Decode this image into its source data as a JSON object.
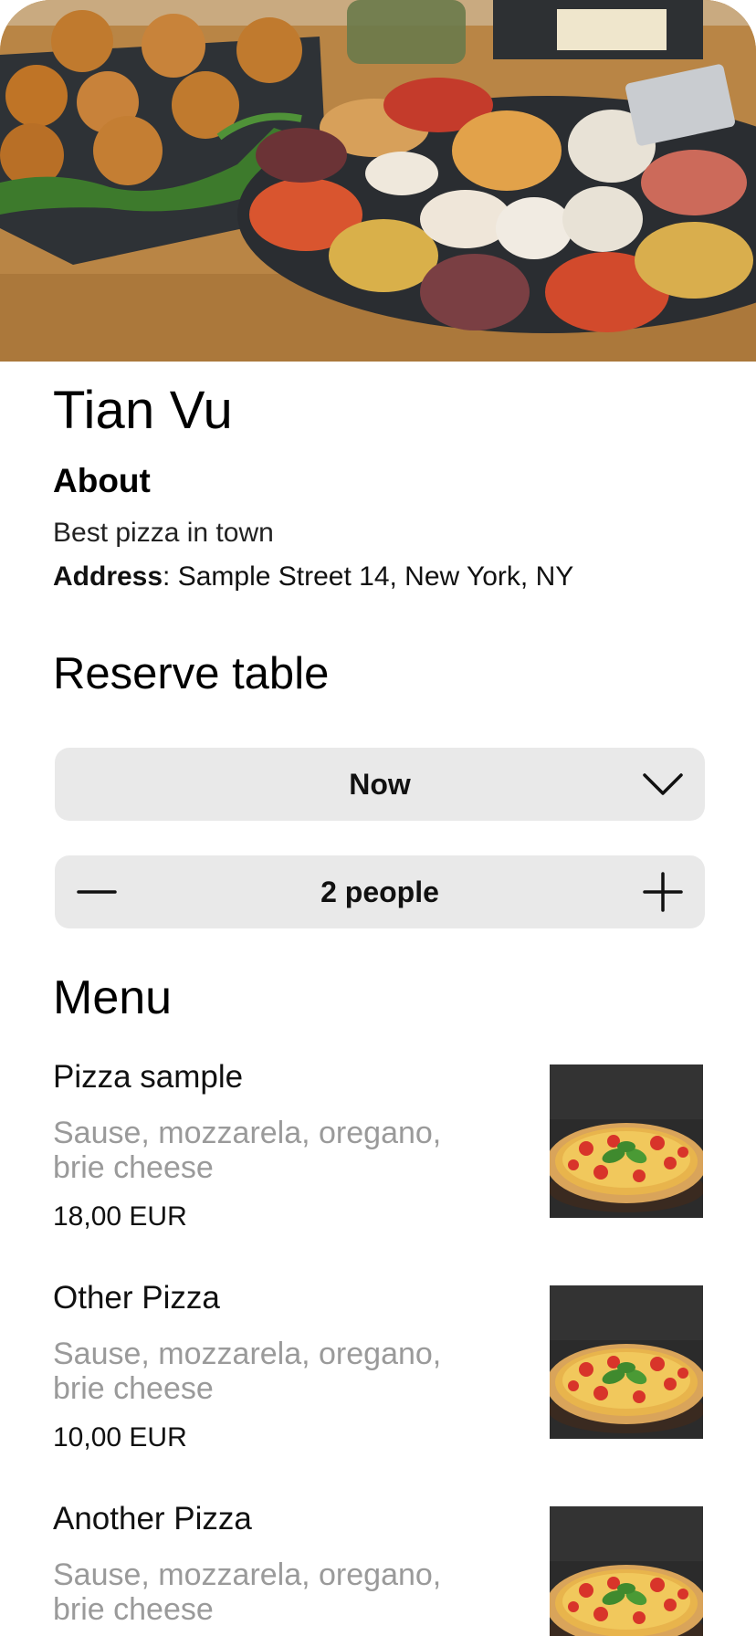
{
  "restaurant": {
    "name": "Tian Vu",
    "hero_image": "food-platter-photo"
  },
  "about": {
    "heading": "About",
    "description": "Best pizza in town",
    "address_label": "Address",
    "address_value": ": Sample Street 14, New York, NY"
  },
  "reservation": {
    "heading": "Reserve table",
    "time_value": "Now",
    "time_icon": "chevron-down-icon",
    "party_size": "2 people",
    "decrement_icon": "minus-icon",
    "increment_icon": "plus-icon"
  },
  "menu": {
    "heading": "Menu",
    "items": [
      {
        "name": "Pizza sample",
        "description": "Sause, mozzarela, oregano, brie cheese",
        "price": "18,00 EUR",
        "image": "pizza-photo"
      },
      {
        "name": "Other Pizza",
        "description": "Sause, mozzarela, oregano, brie cheese",
        "price": "10,00 EUR",
        "image": "pizza-photo"
      },
      {
        "name": "Another Pizza",
        "description": "Sause, mozzarela, oregano, brie cheese",
        "price": "",
        "image": "pizza-photo"
      }
    ]
  },
  "colors": {
    "control_background": "#e9e9e9",
    "secondary_text": "#9a9a9a",
    "primary_text": "#000000"
  }
}
